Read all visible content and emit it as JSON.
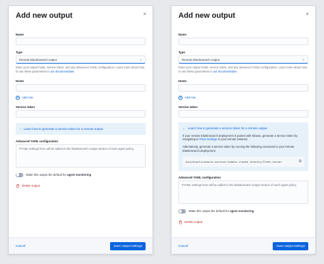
{
  "panels": [
    {
      "title": "Add new output",
      "close_glyph": "×",
      "name_label": "Name",
      "type_label": "Type",
      "type_value": "Remote Elasticsearch output",
      "help_text": "Enter your output hosts, service token, and any advanced YAML configuration. Learn more about how to use these parameters in ",
      "help_link": "our documentation",
      "help_end": ".",
      "hosts_label": "Hosts",
      "add_row": "Add row",
      "service_token_label": "Service token",
      "callout_title": "Learn how to generate a service token for a remote output.",
      "advanced_yaml_label": "Advanced YAML configuration",
      "yaml_placeholder": "#YAML settings here will be added to the Elasticsearch output section of each agent policy.",
      "toggle_prefix": "Make this output the default for ",
      "toggle_bold": "agent monitoring",
      "toggle_suffix": ".",
      "delete_label": "Delete output",
      "cancel_label": "Cancel",
      "save_label": "Save output settings"
    },
    {
      "title": "Add new output",
      "close_glyph": "×",
      "name_label": "Name",
      "type_label": "Type",
      "type_value": "Remote Elasticsearch output",
      "help_text": "Enter your output hosts, service token, and any advanced YAML configuration. Learn more about how to use these parameters in ",
      "help_link": "our documentation",
      "help_end": ".",
      "hosts_label": "Hosts",
      "add_row": "Add row",
      "service_token_label": "Service token",
      "callout_title": "Learn how to generate a service token for a remote output.",
      "callout_p1_start": "If your remote Elasticsearch deployment is paired with Kibana, generate a service token by navigating to ",
      "callout_p1_link": "Fleet Settings",
      "callout_p1_end": " in your remote instance.",
      "callout_p2": "Alternatively, generate a service token by running the following command in your remote Elasticsearch deployment:",
      "command": "bin/elasticsearch-service-tokens create elastic/fleet-server",
      "advanced_yaml_label": "Advanced YAML configuration",
      "yaml_placeholder": "#YAML settings here will be added to the Elasticsearch output section of each agent policy.",
      "toggle_prefix": "Make this output the default for ",
      "toggle_bold": "agent monitoring",
      "toggle_suffix": ".",
      "delete_label": "Delete output",
      "cancel_label": "Cancel",
      "save_label": "Save output settings"
    }
  ],
  "colors": {
    "accent": "#0b64dd",
    "danger": "#bd271e",
    "callout_bg": "#e6f1fa"
  }
}
